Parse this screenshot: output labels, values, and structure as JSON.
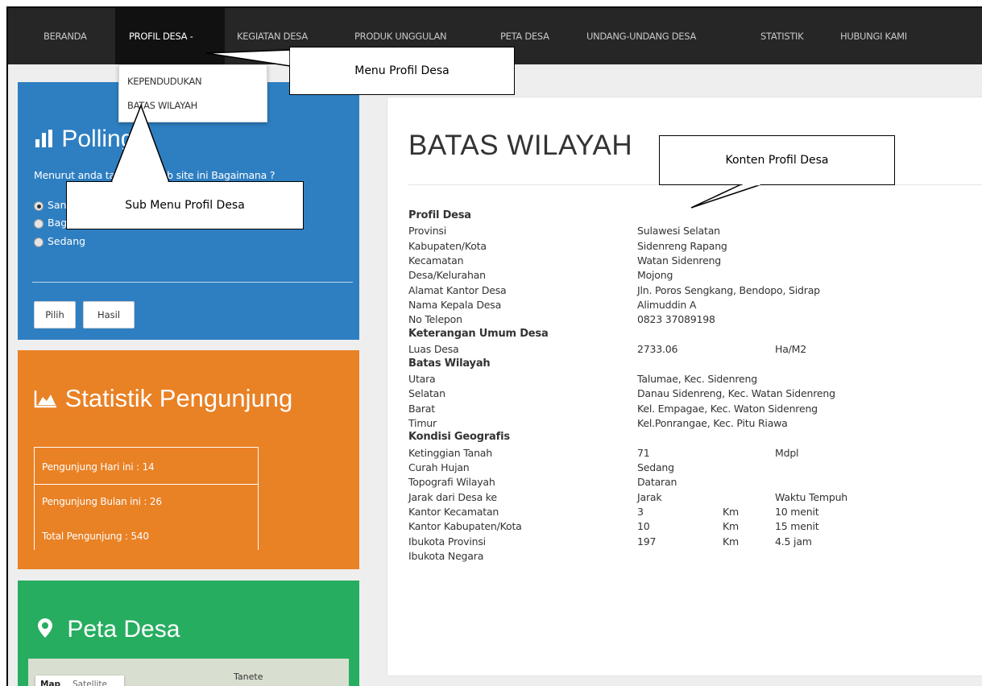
{
  "nav": {
    "items": [
      {
        "label": "BERANDA"
      },
      {
        "label": "PROFIL DESA -"
      },
      {
        "label": "KEGIATAN DESA"
      },
      {
        "label": "PRODUK UNGGULAN"
      },
      {
        "label": "PETA DESA"
      },
      {
        "label": "UNDANG-UNDANG DESA"
      },
      {
        "label": "STATISTIK"
      },
      {
        "label": "HUBUNGI KAMI"
      }
    ],
    "active": "PROFIL DESA -"
  },
  "dropdown": {
    "items": [
      {
        "label": "KEPENDUDUKAN"
      },
      {
        "label": "BATAS WILAYAH"
      }
    ]
  },
  "polling": {
    "title": "Polling",
    "question": "Menurut anda tampilan Web site ini Bagaimana ?",
    "options": [
      {
        "label": "Sangat Bagus",
        "checked": true
      },
      {
        "label": "Bagus",
        "checked": false
      },
      {
        "label": "Sedang",
        "checked": false
      }
    ],
    "buttons": {
      "vote": "Pilih",
      "result": "Hasil"
    }
  },
  "statistik": {
    "title": "Statistik Pengunjung",
    "today": "Pengunjung Hari ini : 14",
    "month": "Pengunjung Bulan ini : 26",
    "total": "Total Pengunjung : 540"
  },
  "peta": {
    "title": "Peta Desa",
    "map_btn": "Map",
    "satellite_btn": "Satellite",
    "town": "Tanete"
  },
  "content": {
    "title": "BATAS WILAYAH",
    "rows": [
      {
        "c1": "Profil Desa",
        "c2": "",
        "c3": "",
        "c4": "",
        "head": true
      },
      {
        "c1": "Provinsi",
        "c2": "Sulawesi Selatan",
        "c3": "",
        "c4": ""
      },
      {
        "c1": "Kabupaten/Kota",
        "c2": "Sidenreng Rapang",
        "c3": "",
        "c4": ""
      },
      {
        "c1": "Kecamatan",
        "c2": "Watan Sidenreng",
        "c3": "",
        "c4": ""
      },
      {
        "c1": "Desa/Kelurahan",
        "c2": "Mojong",
        "c3": "",
        "c4": ""
      },
      {
        "c1": "Alamat Kantor Desa",
        "c2": "Jln. Poros Sengkang, Bendopo, Sidrap",
        "c3": "",
        "c4": ""
      },
      {
        "c1": "Nama Kepala Desa",
        "c2": "Alimuddin A",
        "c3": "",
        "c4": ""
      },
      {
        "c1": "No Telepon",
        "c2": "0823 37089198",
        "c3": "",
        "c4": ""
      },
      {
        "c1": "Keterangan Umum Desa",
        "c2": "",
        "c3": "",
        "c4": "",
        "head": true
      },
      {
        "c1": "Luas Desa",
        "c2": "2733.06",
        "c3": "",
        "c4": "Ha/M2"
      },
      {
        "c1": "Batas Wilayah",
        "c2": "",
        "c3": "",
        "c4": "",
        "head": true
      },
      {
        "c1": "Utara",
        "c2": "Talumae, Kec. Sidenreng",
        "c3": "",
        "c4": ""
      },
      {
        "c1": "Selatan",
        "c2": "Danau Sidenreng, Kec. Watan Sidenreng",
        "c3": "",
        "c4": ""
      },
      {
        "c1": "Barat",
        "c2": "Kel. Empagae, Kec. Waton Sidenreng",
        "c3": "",
        "c4": ""
      },
      {
        "c1": "Timur",
        "c2": "Kel.Ponrangae, Kec. Pitu Riawa",
        "c3": "",
        "c4": ""
      },
      {
        "c1": "Kondisi Geografis",
        "c2": "",
        "c3": "",
        "c4": "",
        "head": true
      },
      {
        "c1": "Ketinggian Tanah",
        "c2": "71",
        "c3": "",
        "c4": "Mdpl"
      },
      {
        "c1": "Curah Hujan",
        "c2": "Sedang",
        "c3": "",
        "c4": ""
      },
      {
        "c1": "Topografi Wilayah",
        "c2": "Dataran",
        "c3": "",
        "c4": ""
      },
      {
        "c1": "Jarak dari Desa ke",
        "c2": "Jarak",
        "c3": "",
        "c4": "Waktu Tempuh"
      },
      {
        "c1": "Kantor Kecamatan",
        "c2": "3",
        "c3": "Km",
        "c4": "10 menit"
      },
      {
        "c1": "Kantor Kabupaten/Kota",
        "c2": "10",
        "c3": "Km",
        "c4": "15 menit"
      },
      {
        "c1": "Ibukota Provinsi",
        "c2": "197",
        "c3": "Km",
        "c4": "4.5 jam"
      },
      {
        "c1": "Ibukota Negara",
        "c2": "",
        "c3": "",
        "c4": ""
      }
    ]
  },
  "callouts": {
    "menu": "Menu Profil Desa",
    "submenu": "Sub Menu Profil Desa",
    "konten": "Konten  Profil Desa"
  }
}
